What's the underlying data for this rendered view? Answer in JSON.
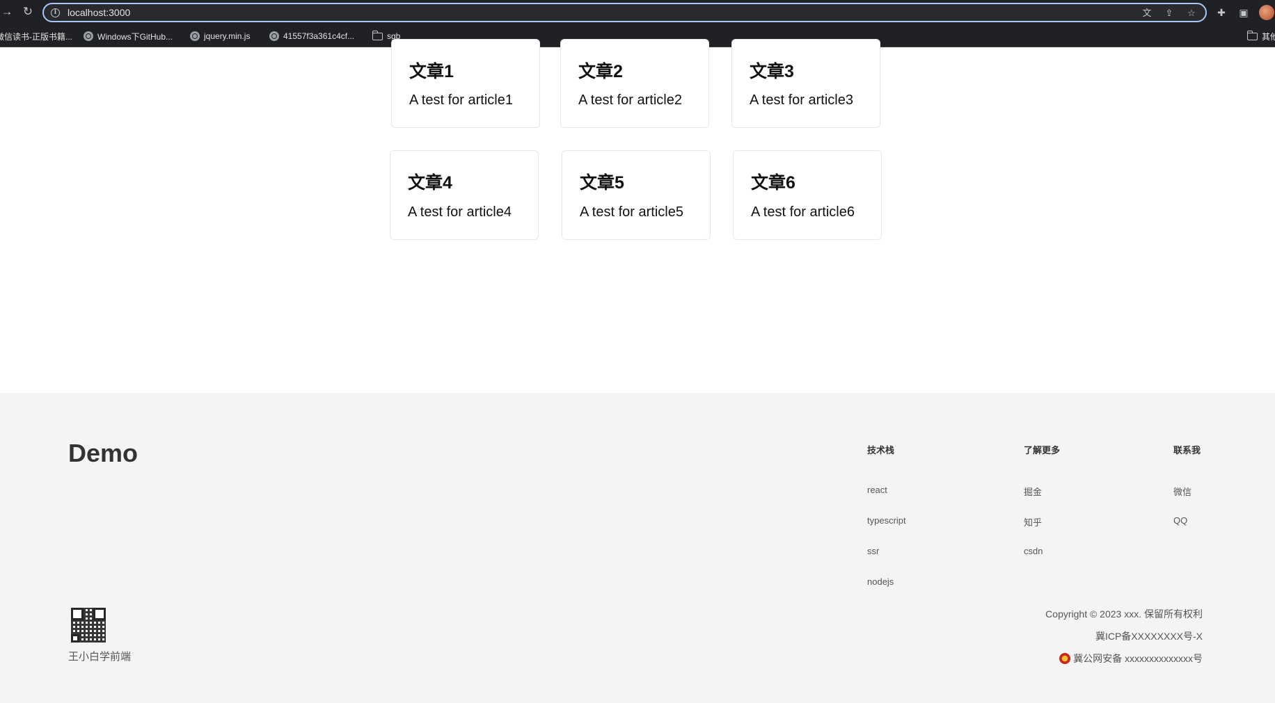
{
  "browser": {
    "url": "localhost:3000",
    "bookmarks": [
      "微信读书-正版书籍...",
      "Windows下GitHub...",
      "jquery.min.js",
      "41557f3a361c4cf...",
      "sgb"
    ],
    "other_bookmarks": "其他"
  },
  "articles": [
    {
      "title": "文章1",
      "desc": "A test for article1"
    },
    {
      "title": "文章2",
      "desc": "A test for article2"
    },
    {
      "title": "文章3",
      "desc": "A test for article3"
    },
    {
      "title": "文章4",
      "desc": "A test for article4"
    },
    {
      "title": "文章5",
      "desc": "A test for article5"
    },
    {
      "title": "文章6",
      "desc": "A test for article6"
    }
  ],
  "footer": {
    "brand": "Demo",
    "columns": [
      {
        "heading": "技术栈",
        "links": [
          "react",
          "typescript",
          "ssr",
          "nodejs"
        ]
      },
      {
        "heading": "了解更多",
        "links": [
          "掘金",
          "知乎",
          "csdn"
        ]
      },
      {
        "heading": "联系我",
        "links": [
          "微信",
          "QQ"
        ]
      }
    ],
    "qr_caption": "王小白学前端",
    "copyright": "Copyright © 2023 xxx. 保留所有权利",
    "icp": "冀ICP备XXXXXXXX号-X",
    "police": "冀公网安备 xxxxxxxxxxxxxx号"
  }
}
